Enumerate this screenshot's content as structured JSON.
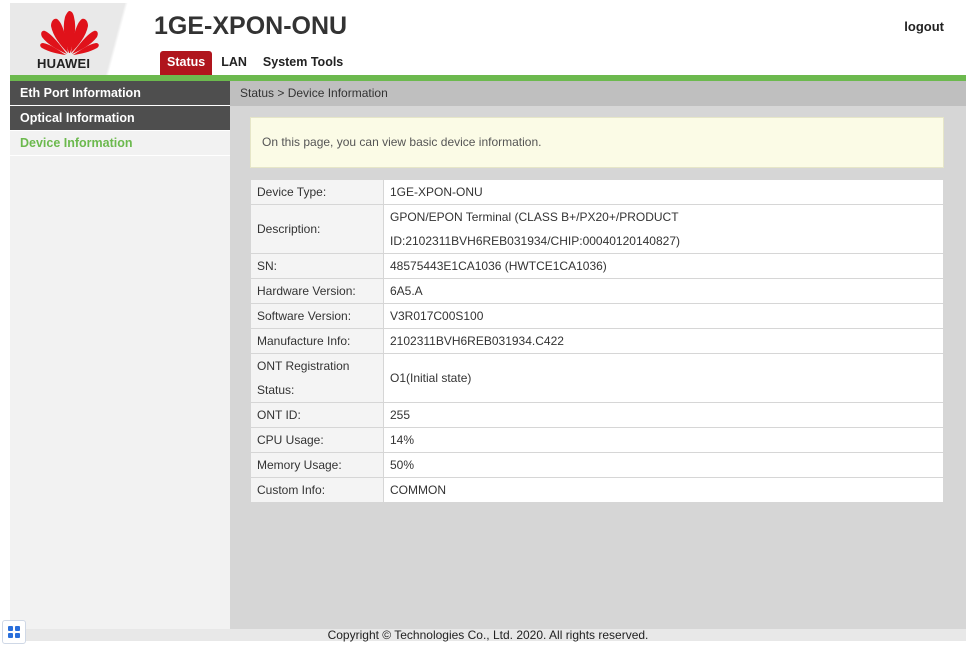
{
  "brand": {
    "logo_text": "HUAWEI",
    "color": "#e0121a"
  },
  "header": {
    "device_title": "1GE-XPON-ONU",
    "logout_label": "logout"
  },
  "tabs": [
    {
      "label": "Status",
      "active": true
    },
    {
      "label": "LAN",
      "active": false
    },
    {
      "label": "System Tools",
      "active": false
    }
  ],
  "sidebar": {
    "items": [
      {
        "label": "Eth Port Information",
        "active": false
      },
      {
        "label": "Optical Information",
        "active": false
      },
      {
        "label": "Device Information",
        "active": true
      }
    ]
  },
  "breadcrumb": "Status > Device Information",
  "note": "On this page, you can view basic device information.",
  "device_info": {
    "rows": [
      {
        "key": "Device Type:",
        "value": "1GE-XPON-ONU"
      },
      {
        "key": "Description:",
        "value_line1": "GPON/EPON Terminal (CLASS B+/PX20+/PRODUCT",
        "value_line2": "ID:2102311BVH6REB031934/CHIP:00040120140827)"
      },
      {
        "key": "SN:",
        "value": "48575443E1CA1036 (HWTCE1CA1036)"
      },
      {
        "key": "Hardware Version:",
        "value": "6A5.A"
      },
      {
        "key": "Software Version:",
        "value": "V3R017C00S100"
      },
      {
        "key": "Manufacture Info:",
        "value": "2102311BVH6REB031934.C422"
      },
      {
        "key_line1": "ONT Registration",
        "key_line2": "Status:",
        "value": "O1(Initial state)"
      },
      {
        "key": "ONT ID:",
        "value": "255"
      },
      {
        "key": "CPU Usage:",
        "value": "14%"
      },
      {
        "key": "Memory Usage:",
        "value": "50%"
      },
      {
        "key": "Custom Info:",
        "value": "COMMON"
      }
    ]
  },
  "footer": {
    "copyright": "Copyright © Technologies Co., Ltd. 2020. All rights reserved."
  },
  "colors": {
    "accent_red": "#b0151d",
    "accent_green": "#6cb94e",
    "sidebar_dark": "#4e4e4e"
  },
  "corner_widget": {
    "icon": "grid-icon"
  }
}
